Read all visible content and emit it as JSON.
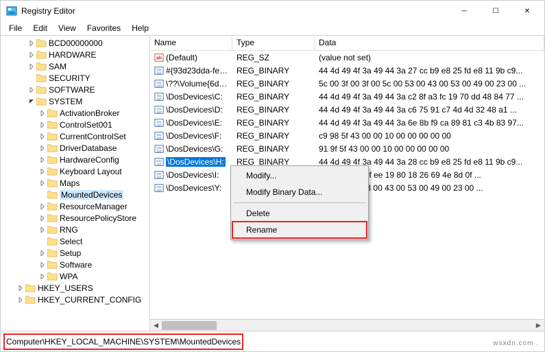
{
  "window": {
    "title": "Registry Editor"
  },
  "controls": {
    "minimize": "─",
    "maximize": "☐",
    "close": "✕"
  },
  "menubar": [
    "File",
    "Edit",
    "View",
    "Favorites",
    "Help"
  ],
  "tree": {
    "nodes": [
      {
        "level": 2,
        "exp": ">",
        "label": "BCD00000000"
      },
      {
        "level": 2,
        "exp": ">",
        "label": "HARDWARE"
      },
      {
        "level": 2,
        "exp": ">",
        "label": "SAM"
      },
      {
        "level": 2,
        "exp": "",
        "label": "SECURITY"
      },
      {
        "level": 2,
        "exp": ">",
        "label": "SOFTWARE"
      },
      {
        "level": 2,
        "exp": "v",
        "label": "SYSTEM"
      },
      {
        "level": 3,
        "exp": ">",
        "label": "ActivationBroker"
      },
      {
        "level": 3,
        "exp": ">",
        "label": "ControlSet001"
      },
      {
        "level": 3,
        "exp": ">",
        "label": "CurrentControlSet"
      },
      {
        "level": 3,
        "exp": ">",
        "label": "DriverDatabase"
      },
      {
        "level": 3,
        "exp": ">",
        "label": "HardwareConfig"
      },
      {
        "level": 3,
        "exp": ">",
        "label": "Keyboard Layout"
      },
      {
        "level": 3,
        "exp": ">",
        "label": "Maps"
      },
      {
        "level": 3,
        "exp": "",
        "label": "MountedDevices",
        "selected": true
      },
      {
        "level": 3,
        "exp": ">",
        "label": "ResourceManager"
      },
      {
        "level": 3,
        "exp": ">",
        "label": "ResourcePolicyStore"
      },
      {
        "level": 3,
        "exp": ">",
        "label": "RNG"
      },
      {
        "level": 3,
        "exp": "",
        "label": "Select"
      },
      {
        "level": 3,
        "exp": ">",
        "label": "Setup"
      },
      {
        "level": 3,
        "exp": ">",
        "label": "Software"
      },
      {
        "level": 3,
        "exp": ">",
        "label": "WPA"
      },
      {
        "level": 1,
        "exp": ">",
        "label": "HKEY_USERS"
      },
      {
        "level": 1,
        "exp": ">",
        "label": "HKEY_CURRENT_CONFIG"
      }
    ]
  },
  "list": {
    "headers": {
      "name": "Name",
      "type": "Type",
      "data": "Data"
    },
    "rows": [
      {
        "icon": "str",
        "name": "(Default)",
        "type": "REG_SZ",
        "data": "(value not set)"
      },
      {
        "icon": "bin",
        "name": "#{93d23dda-fe8...",
        "type": "REG_BINARY",
        "data": "44 4d 49 4f 3a 49 44 3a 27 cc b9 e8 25 fd e8 11 9b c9..."
      },
      {
        "icon": "bin",
        "name": "\\??\\Volume{6d0...",
        "type": "REG_BINARY",
        "data": "5c 00 3f 00 3f 00 5c 00 53 00 43 00 53 00 49 00 23 00 ..."
      },
      {
        "icon": "bin",
        "name": "\\DosDevices\\C:",
        "type": "REG_BINARY",
        "data": "44 4d 49 4f 3a 49 44 3a c2 8f a3 fc 19 70 dd 48 84 77 ..."
      },
      {
        "icon": "bin",
        "name": "\\DosDevices\\D:",
        "type": "REG_BINARY",
        "data": "44 4d 49 4f 3a 49 44 3a c6 75 91 c7 4d 4d 32 48 a1 ..."
      },
      {
        "icon": "bin",
        "name": "\\DosDevices\\E:",
        "type": "REG_BINARY",
        "data": "44 4d 49 4f 3a 49 44 3a 6e 8b f9 ca 89 81 c3 4b 83 97..."
      },
      {
        "icon": "bin",
        "name": "\\DosDevices\\F:",
        "type": "REG_BINARY",
        "data": "c9 98 5f 43 00 00 10 00 00 00 00 00"
      },
      {
        "icon": "bin",
        "name": "\\DosDevices\\G:",
        "type": "REG_BINARY",
        "data": "91 9f 5f 43 00 00 10 00 00 00 00 00"
      },
      {
        "icon": "bin",
        "name": "\\DosDevices\\H:",
        "type": "REG_BINARY",
        "data": "44 4d 49 4f 3a 49 44 3a 28 cc b9 e8 25 fd e8 11 9b c9...",
        "selected": true
      },
      {
        "icon": "bin",
        "name": "\\DosDevices\\I:",
        "type": "REG_BINARY",
        "data": "3a 49 44 3a 5f ee 19 80 18 26 69 4e 8d 0f ..."
      },
      {
        "icon": "bin",
        "name": "\\DosDevices\\Y:",
        "type": "REG_BINARY",
        "data": "3f 00 5c 00 53 00 43 00 53 00 49 00 23 00 ..."
      }
    ]
  },
  "contextMenu": {
    "modify": "Modify...",
    "modifyBinary": "Modify Binary Data...",
    "delete": "Delete",
    "rename": "Rename"
  },
  "statusbar": {
    "path": "Computer\\HKEY_LOCAL_MACHINE\\SYSTEM\\MountedDevices"
  },
  "watermark": "wsxdn.com ."
}
